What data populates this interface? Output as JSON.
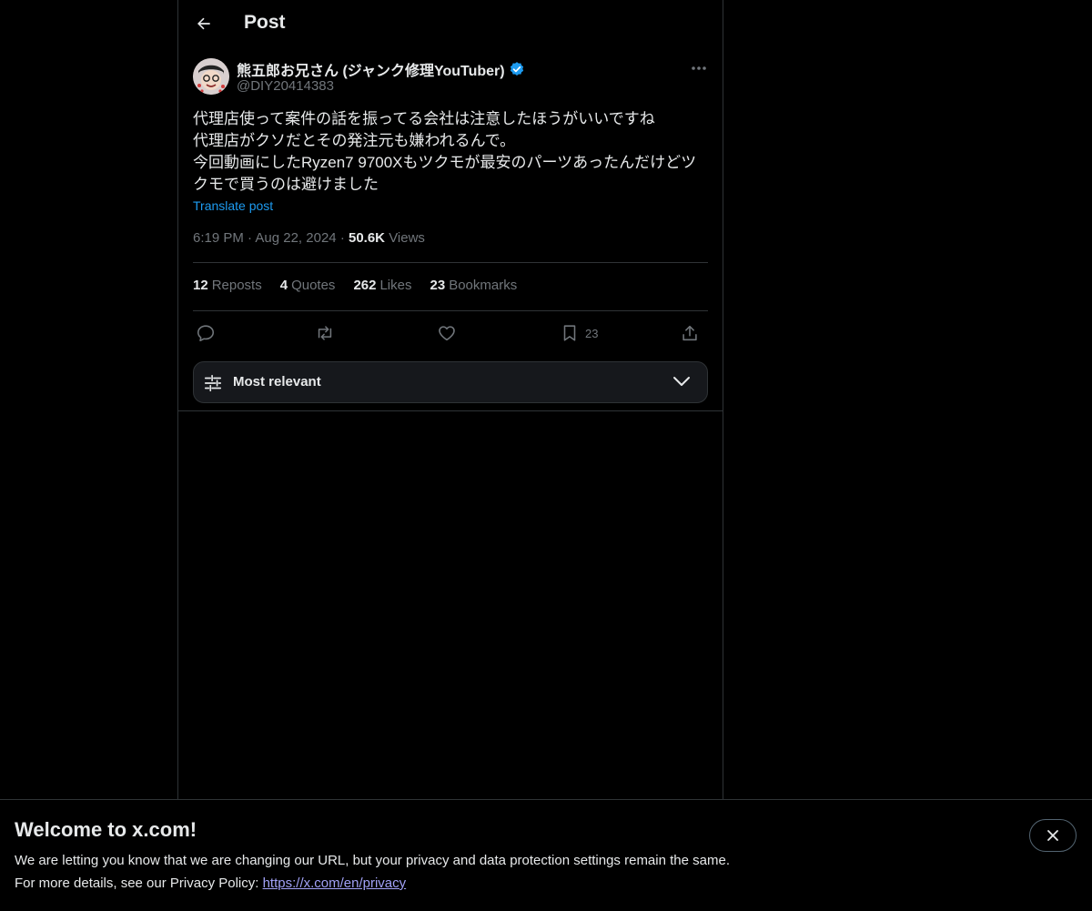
{
  "header": {
    "title": "Post"
  },
  "post": {
    "author_name": "熊五郎お兄さん (ジャンク修理YouTuber)",
    "handle": "@DIY20414383",
    "text": "代理店使って案件の話を振ってる会社は注意したほうがいいですね\n代理店がクソだとその発注元も嫌われるんで。\n今回動画にしたRyzen7 9700Xもツクモが最安のパーツあったんだけどツクモで買うのは避けました",
    "translate_label": "Translate post",
    "time": "6:19 PM",
    "date": "Aug 22, 2024",
    "views_count": "50.6K",
    "views_label": "Views"
  },
  "stats": [
    {
      "count": "12",
      "label": "Reposts"
    },
    {
      "count": "4",
      "label": "Quotes"
    },
    {
      "count": "262",
      "label": "Likes"
    },
    {
      "count": "23",
      "label": "Bookmarks"
    }
  ],
  "actions": {
    "bookmark_count": "23",
    "icons": [
      "reply-icon",
      "repost-icon",
      "like-icon",
      "bookmark-icon",
      "share-icon"
    ]
  },
  "sort": {
    "label": "Most relevant"
  },
  "banner": {
    "title": "Welcome to x.com!",
    "line1": "We are letting you know that we are changing our URL, but your privacy and data protection settings remain the same.",
    "line2_prefix": "For more details, see our Privacy Policy: ",
    "link": "https://x.com/en/privacy"
  },
  "colors": {
    "background": "#000000",
    "accent": "#1d9bf0",
    "muted": "#71767b",
    "border": "#2f3336",
    "link_visited": "#a1a1f6"
  }
}
